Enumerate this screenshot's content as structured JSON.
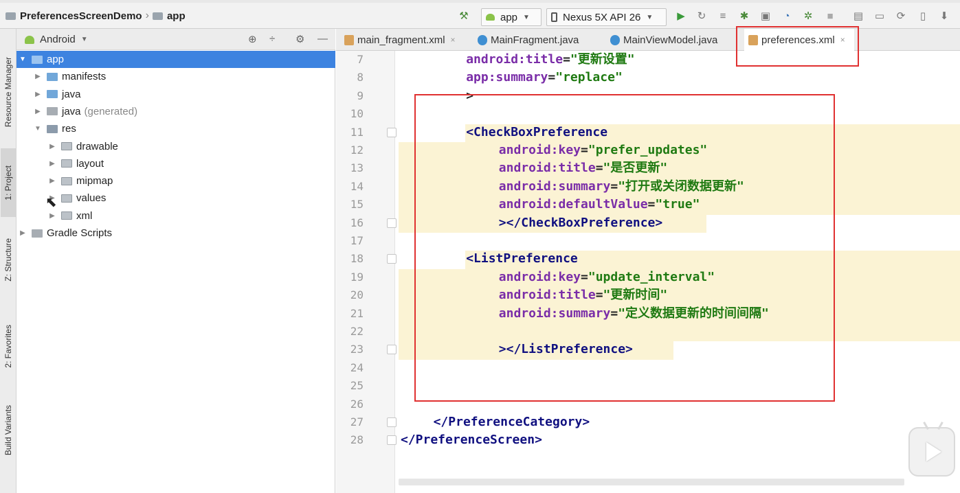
{
  "nav": {
    "project": "PreferencesScreenDemo",
    "module": "app"
  },
  "toolbar": {
    "run_config": "app",
    "device": "Nexus 5X API 26",
    "icons": [
      "hammer-icon",
      "run-icon",
      "rerun-icon",
      "coverage-icon",
      "debug-icon",
      "attach-icon",
      "profile-icon",
      "apply-changes-icon",
      "stop-icon",
      "project-structure-icon",
      "terminal-icon",
      "sync-icon",
      "avd-icon",
      "sdk-icon"
    ]
  },
  "left_strip": {
    "tabs": [
      "Resource Manager",
      "1: Project",
      "Z: Structure",
      "2: Favorites",
      "Build Variants"
    ]
  },
  "project_panel": {
    "view": "Android",
    "tree": [
      {
        "label": "app",
        "extra": "",
        "level": 0,
        "expanded": true,
        "selected": true
      },
      {
        "label": "manifests",
        "extra": "",
        "level": 1,
        "expanded": false,
        "selected": false
      },
      {
        "label": "java",
        "extra": "",
        "level": 1,
        "expanded": false,
        "selected": false
      },
      {
        "label": "java",
        "extra": "(generated)",
        "level": 1,
        "expanded": false,
        "selected": false
      },
      {
        "label": "res",
        "extra": "",
        "level": 1,
        "expanded": true,
        "selected": false
      },
      {
        "label": "drawable",
        "extra": "",
        "level": 2,
        "expanded": false,
        "selected": false
      },
      {
        "label": "layout",
        "extra": "",
        "level": 2,
        "expanded": false,
        "selected": false
      },
      {
        "label": "mipmap",
        "extra": "",
        "level": 2,
        "expanded": false,
        "selected": false
      },
      {
        "label": "values",
        "extra": "",
        "level": 2,
        "expanded": false,
        "selected": false
      },
      {
        "label": "xml",
        "extra": "",
        "level": 2,
        "expanded": false,
        "selected": false
      },
      {
        "label": "Gradle Scripts",
        "extra": "",
        "level": 0,
        "expanded": false,
        "selected": false
      }
    ]
  },
  "editor_tabs": [
    {
      "label": "main_fragment.xml",
      "kind": "xml",
      "active": false
    },
    {
      "label": "MainFragment.java",
      "kind": "java",
      "active": false
    },
    {
      "label": "MainViewModel.java",
      "kind": "java",
      "active": false
    },
    {
      "label": "preferences.xml",
      "kind": "xml",
      "active": true
    }
  ],
  "editor": {
    "lines": [
      {
        "n": "7",
        "indent": 8,
        "parts": [
          [
            "attr",
            "android:title"
          ],
          [
            "eq",
            "="
          ],
          [
            "str",
            "\"更新设置\""
          ]
        ]
      },
      {
        "n": "8",
        "indent": 8,
        "parts": [
          [
            "attr",
            "app:summary"
          ],
          [
            "eq",
            "="
          ],
          [
            "str",
            "\"replace\""
          ]
        ]
      },
      {
        "n": "9",
        "indent": 8,
        "parts": [
          [
            "plain",
            ">"
          ]
        ]
      },
      {
        "n": "10",
        "indent": 0,
        "parts": []
      },
      {
        "n": "11",
        "indent": 8,
        "parts": [
          [
            "tag",
            "<CheckBoxPreference"
          ]
        ]
      },
      {
        "n": "12",
        "indent": 12,
        "parts": [
          [
            "attr",
            "android:key"
          ],
          [
            "eq",
            "="
          ],
          [
            "str",
            "\"prefer_updates\""
          ]
        ]
      },
      {
        "n": "13",
        "indent": 12,
        "parts": [
          [
            "attr",
            "android:title"
          ],
          [
            "eq",
            "="
          ],
          [
            "str",
            "\"是否更新\""
          ]
        ]
      },
      {
        "n": "14",
        "indent": 12,
        "parts": [
          [
            "attr",
            "android:summary"
          ],
          [
            "eq",
            "="
          ],
          [
            "str",
            "\"打开或关闭数据更新\""
          ]
        ]
      },
      {
        "n": "15",
        "indent": 12,
        "parts": [
          [
            "attr",
            "android:defaultValue"
          ],
          [
            "eq",
            "="
          ],
          [
            "str",
            "\"true\""
          ]
        ]
      },
      {
        "n": "16",
        "indent": 12,
        "parts": [
          [
            "tag",
            "></CheckBoxPreference>"
          ]
        ]
      },
      {
        "n": "17",
        "indent": 0,
        "parts": []
      },
      {
        "n": "18",
        "indent": 8,
        "parts": [
          [
            "tag",
            "<ListPreference"
          ]
        ]
      },
      {
        "n": "19",
        "indent": 12,
        "parts": [
          [
            "attr",
            "android:key"
          ],
          [
            "eq",
            "="
          ],
          [
            "str",
            "\"update_interval\""
          ]
        ]
      },
      {
        "n": "20",
        "indent": 12,
        "parts": [
          [
            "attr",
            "android:title"
          ],
          [
            "eq",
            "="
          ],
          [
            "str",
            "\"更新时间\""
          ]
        ]
      },
      {
        "n": "21",
        "indent": 12,
        "parts": [
          [
            "attr",
            "android:summary"
          ],
          [
            "eq",
            "="
          ],
          [
            "str",
            "\"定义数据更新的时间间隔\""
          ]
        ]
      },
      {
        "n": "22",
        "indent": 0,
        "parts": []
      },
      {
        "n": "23",
        "indent": 12,
        "parts": [
          [
            "tag",
            "></ListPreference>"
          ]
        ]
      },
      {
        "n": "24",
        "indent": 0,
        "parts": []
      },
      {
        "n": "25",
        "indent": 0,
        "parts": []
      },
      {
        "n": "26",
        "indent": 0,
        "parts": []
      },
      {
        "n": "27",
        "indent": 4,
        "parts": [
          [
            "tag",
            "</PreferenceCategory>"
          ]
        ]
      },
      {
        "n": "28",
        "indent": 0,
        "parts": [
          [
            "tag",
            "</PreferenceScreen>"
          ]
        ]
      }
    ]
  },
  "colors": {
    "selection": "#3d83e0",
    "annotation": "#e03030",
    "highlight": "#fbf3d4",
    "attr": "#7a2da8",
    "string": "#1f7a12",
    "tag": "#101080"
  }
}
